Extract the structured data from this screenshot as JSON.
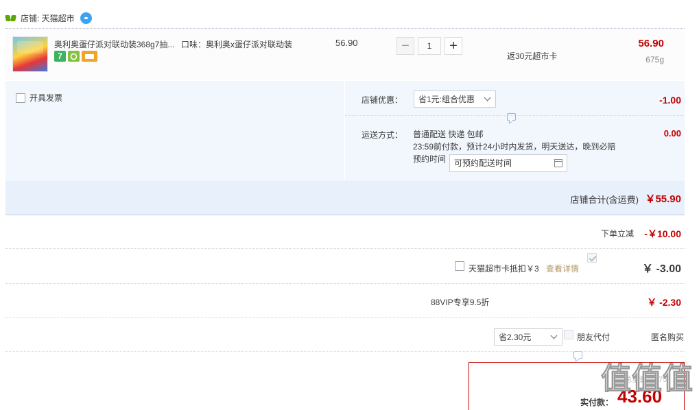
{
  "shop": {
    "label": "店铺: 天猫超市"
  },
  "item": {
    "title": "奥利奥蛋仔派对联动装368g7抽...",
    "flavor": "口味：奥利奥x蛋仔派对联动装",
    "badge_seven": "7",
    "unit_price": "56.90",
    "quantity": "1",
    "minus": "−",
    "plus": "+",
    "rebate": "返30元超市卡",
    "line_total": "56.90",
    "weight": "675g"
  },
  "options": {
    "invoice_label": "开具发票",
    "shop_discount_label": "店铺优惠：",
    "shop_discount_select": "省1元:组合优惠",
    "shop_discount_amount": "-1.00",
    "shipping_label": "运送方式：",
    "shipping_method": "普通配送 快递 包邮",
    "shipping_desc": "23:59前付款，预计24小时内发货，明天送达，晚到必赔",
    "appointment_label": "预约时间",
    "appointment_placeholder": "可预约配送时间",
    "shipping_amount": "0.00"
  },
  "shop_total": {
    "label": "店铺合计(含运费)",
    "amount": "￥55.90"
  },
  "discounts": {
    "instant_label": "下单立减",
    "instant_amount": "-￥10.00",
    "card_label": "天猫超市卡抵扣￥3",
    "card_link": "查看详情",
    "card_amount": "￥ -3.00",
    "vip_label": "88VIP专享9.5折",
    "vip_select": "省2.30元",
    "vip_amount": "￥ -2.30"
  },
  "checkout_options": {
    "friend_pay": "朋友代付",
    "anonymous": "匿名购买"
  },
  "summary": {
    "weight": "总重量：675",
    "pay_label": "实付款：",
    "pay_amount": "43.60"
  },
  "watermark": "值值值",
  "colors": {
    "price_red": "#c40000",
    "section_bg": "#f1f7fd",
    "total_bar_bg": "#e8f1fb",
    "checkbox_blue": "#4d79d8",
    "link_gold": "#b39b6b"
  }
}
